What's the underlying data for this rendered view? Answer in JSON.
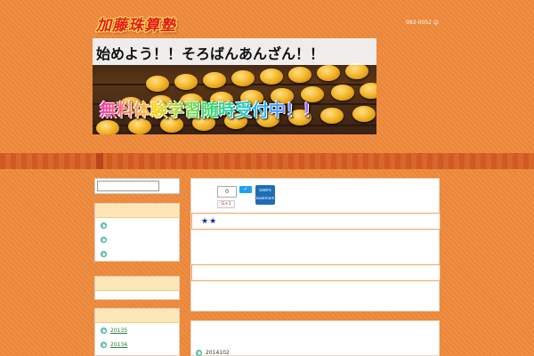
{
  "header": {
    "logo_text": "加藤珠算塾",
    "info_text": "083-0052 ☺"
  },
  "banner": {
    "title": "始めよう！！そろばんあんざん！！",
    "caption": "無料体験学習随時受付中！！"
  },
  "sidebar": {
    "search": {
      "value": "",
      "placeholder": ""
    },
    "widget1": {
      "items": [
        "",
        "",
        ""
      ]
    },
    "widget3": {
      "items": [
        "20135",
        "20134"
      ]
    }
  },
  "main": {
    "share": {
      "count": "0",
      "tweet_label": "✓",
      "gplus_label": "G+1",
      "hatena_count": "users",
      "hatena_label": "bookmark"
    },
    "post_title": "★★",
    "archive": {
      "items": [
        "2014102"
      ]
    }
  },
  "colors": {
    "page_background": "#f08a3c",
    "nav_band": "#cf5a22",
    "widget_header": "#fde6b5",
    "link": "#2a7a3a",
    "accent_icon": "#7fd6c8"
  }
}
